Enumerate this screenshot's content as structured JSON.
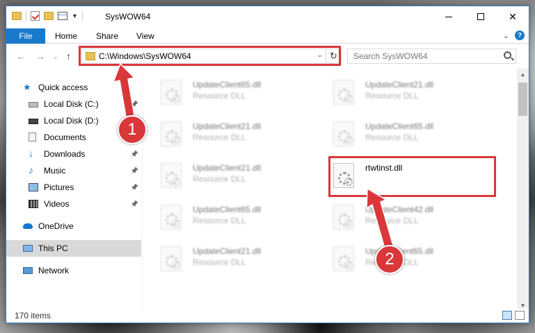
{
  "window": {
    "title": "SysWOW64"
  },
  "ribbon": {
    "tabs": [
      "File",
      "Home",
      "Share",
      "View"
    ]
  },
  "address": {
    "path": "C:\\Windows\\SysWOW64"
  },
  "search": {
    "placeholder": "Search SysWOW64"
  },
  "sidebar": {
    "items": [
      {
        "label": "Quick access",
        "icon": "star-icon"
      },
      {
        "label": "Local Disk (C:)",
        "icon": "drive-icon",
        "pinned": true
      },
      {
        "label": "Local Disk (D:)",
        "icon": "drive-icon",
        "pinned": true
      },
      {
        "label": "Documents",
        "icon": "documents-icon",
        "pinned": true
      },
      {
        "label": "Downloads",
        "icon": "downloads-icon",
        "pinned": true
      },
      {
        "label": "Music",
        "icon": "music-icon",
        "pinned": true
      },
      {
        "label": "Pictures",
        "icon": "pictures-icon",
        "pinned": true
      },
      {
        "label": "Videos",
        "icon": "videos-icon",
        "pinned": true
      },
      {
        "label": "OneDrive",
        "icon": "onedrive-icon"
      },
      {
        "label": "This PC",
        "icon": "pc-icon",
        "selected": true
      },
      {
        "label": "Network",
        "icon": "network-icon"
      }
    ]
  },
  "files": [
    {
      "name": "UpdateClient65.dll",
      "type": "Resource DLL"
    },
    {
      "name": "UpdateClient21.dll",
      "type": "Resource DLL"
    },
    {
      "name": "UpdateClient21.dll",
      "type": "Resource DLL"
    },
    {
      "name": "UpdateClient65.dll",
      "type": "Resource DLL"
    },
    {
      "name": "UpdateClient21.dll",
      "type": "Resource DLL"
    },
    {
      "name": "rtwtinst.dll",
      "type": ""
    },
    {
      "name": "UpdateClient65.dll",
      "type": "Resource DLL"
    },
    {
      "name": "UpdateClient42.dll",
      "type": "Resource DLL"
    },
    {
      "name": "UpdateClient21.dll",
      "type": "Resource DLL"
    },
    {
      "name": "UpdateClient65.dll",
      "type": "Resource DLL"
    }
  ],
  "status": {
    "item_count": "170 items"
  },
  "annotations": {
    "step1": "1",
    "step2": "2"
  },
  "colors": {
    "accent": "#1979ca",
    "highlight": "#d9373a"
  }
}
